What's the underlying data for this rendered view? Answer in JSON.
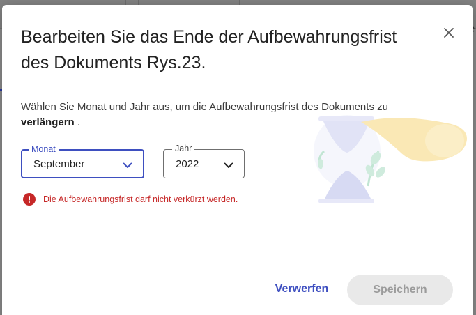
{
  "dialog": {
    "title": "Bearbeiten Sie das Ende der Aufbewahrungsfrist des Dokuments Rys.23.",
    "description_prefix": "Wählen Sie Monat und Jahr aus, um die Aufbewahrungsfrist des Dokuments zu",
    "description_emphasis": "verlängern",
    "description_suffix": " ."
  },
  "month_select": {
    "label": "Monat",
    "value": "September"
  },
  "year_select": {
    "label": "Jahr",
    "value": "2022"
  },
  "error": {
    "message": "Die Aufbewahrungsfrist darf nicht verkürzt werden."
  },
  "footer": {
    "discard_label": "Verwerfen",
    "save_label": "Speichern"
  },
  "background": {
    "partial_text": "e"
  },
  "colors": {
    "accent": "#3e4fc0",
    "error": "#c62828",
    "disabled_bg": "#e9e9e9",
    "disabled_text": "#9b9b9b",
    "overlay": "#8a8a8a"
  },
  "icons": [
    "close-icon",
    "chevron-down-icon",
    "error-icon",
    "hourglass-illustration"
  ]
}
